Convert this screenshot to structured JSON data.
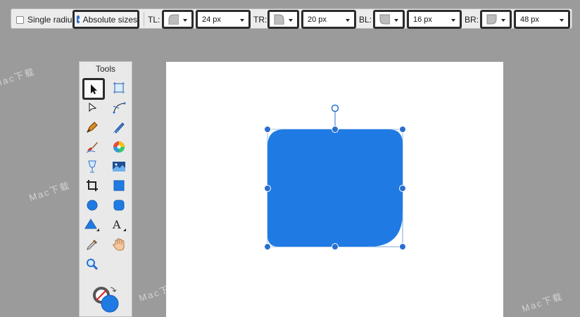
{
  "toolbar": {
    "single_radius": {
      "label": "Single radius",
      "checked": false
    },
    "absolute_sizes": {
      "label": "Absolute sizes",
      "checked": true
    },
    "corners": [
      {
        "label": "TL:",
        "value": "24 px"
      },
      {
        "label": "TR:",
        "value": "20 px"
      },
      {
        "label": "BL:",
        "value": "16 px"
      },
      {
        "label": "BR:",
        "value": "48 px"
      }
    ]
  },
  "tools_panel": {
    "title": "Tools",
    "tools": [
      "select-arrow-icon",
      "crop-frame-icon",
      "node-arrow-icon",
      "bezier-icon",
      "pen-icon",
      "pencil-icon",
      "brush-icon",
      "color-wheel-icon",
      "glass-icon",
      "image-icon",
      "crop-icon",
      "rectangle-icon",
      "ellipse-icon",
      "rounded-rect-icon",
      "triangle-icon",
      "text-icon",
      "eyedropper-icon",
      "hand-icon",
      "zoom-icon"
    ],
    "fill_color": "#1f7be3"
  },
  "shape": {
    "fill": "#1f7be3",
    "handle_color": "#2a6fd0"
  },
  "watermark": "Mac下载"
}
